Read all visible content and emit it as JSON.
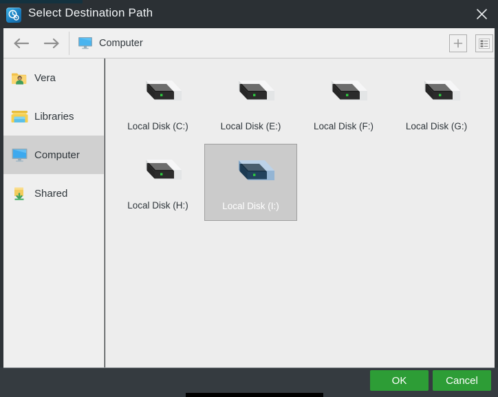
{
  "window": {
    "title": "Select Destination Path",
    "title_icon": "backup-clock-icon",
    "close_icon": "close-icon"
  },
  "navbar": {
    "back_icon": "arrow-left-icon",
    "forward_icon": "arrow-right-icon",
    "breadcrumb": {
      "icon": "computer-monitor-icon",
      "label": "Computer"
    },
    "tools": [
      {
        "name": "new-folder-button",
        "icon": "plus-icon"
      },
      {
        "name": "view-list-button",
        "icon": "list-view-icon"
      }
    ]
  },
  "sidebar": {
    "items": [
      {
        "label": "Vera",
        "icon": "user-folder-icon",
        "selected": false
      },
      {
        "label": "Libraries",
        "icon": "libraries-folder-icon",
        "selected": false
      },
      {
        "label": "Computer",
        "icon": "computer-monitor-icon",
        "selected": true
      },
      {
        "label": "Shared",
        "icon": "shared-folder-icon",
        "selected": false
      }
    ]
  },
  "content": {
    "drives": [
      {
        "label": "Local Disk (C:)",
        "icon": "hard-disk-icon",
        "selected": false
      },
      {
        "label": "Local Disk (E:)",
        "icon": "hard-disk-icon",
        "selected": false
      },
      {
        "label": "Local Disk (F:)",
        "icon": "hard-disk-icon",
        "selected": false
      },
      {
        "label": "Local Disk (G:)",
        "icon": "hard-disk-icon",
        "selected": false
      },
      {
        "label": "Local Disk (H:)",
        "icon": "hard-disk-icon",
        "selected": false
      },
      {
        "label": "Local Disk (I:)",
        "icon": "hard-disk-icon",
        "selected": true
      }
    ]
  },
  "footer": {
    "ok_label": "OK",
    "cancel_label": "Cancel"
  },
  "colors": {
    "titlebar": "#2b3034",
    "footer": "#353b40",
    "accent_green": "#2d9d36",
    "selection_gray": "#cbcbcb",
    "sidebar_selection": "#d0d0d0",
    "content_bg": "#ededed"
  }
}
